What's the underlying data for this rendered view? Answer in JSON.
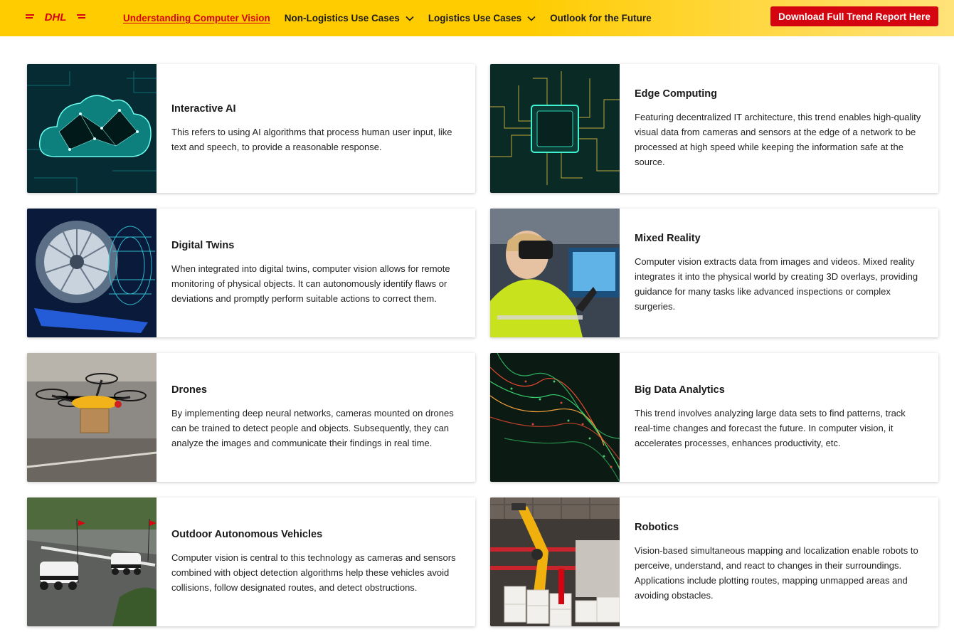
{
  "brand": {
    "logo_text": "DHL",
    "brand_color": "#ffcc00",
    "accent_color": "#d40511"
  },
  "nav": {
    "items": [
      {
        "label": "Understanding Computer Vision",
        "active": true,
        "dropdown": false
      },
      {
        "label": "Non-Logistics Use Cases",
        "active": false,
        "dropdown": true
      },
      {
        "label": "Logistics Use Cases",
        "active": false,
        "dropdown": true
      },
      {
        "label": "Outlook for the Future",
        "active": false,
        "dropdown": false
      }
    ],
    "cta_label": "Download Full Trend Report Here"
  },
  "cards": [
    {
      "title": "Interactive AI",
      "text": "This refers to using AI algorithms that process human user input, like text and speech, to provide a reasonable response.",
      "image": "cloud-network-image"
    },
    {
      "title": "Edge Computing",
      "text": "Featuring decentralized IT architecture, this trend enables high-quality visual data from cameras and sensors at the edge of a network to be processed at high speed while keeping the information safe at the source.",
      "image": "microchip-image"
    },
    {
      "title": "Digital Twins",
      "text": "When integrated into digital twins, computer vision allows for remote monitoring of physical objects. It can autonomously identify flaws or deviations and promptly perform suitable actions to correct them.",
      "image": "jet-engine-image"
    },
    {
      "title": "Mixed Reality",
      "text": "Computer vision extracts data from images and videos. Mixed reality integrates it into the physical world by creating 3D overlays, providing guidance for many tasks like advanced inspections or complex surgeries.",
      "image": "vr-headset-worker-image"
    },
    {
      "title": "Drones",
      "text": "By implementing deep neural networks, cameras mounted on drones can be trained to detect people and objects. Subsequently, they can analyze the images and communicate their findings in real time.",
      "image": "delivery-drone-image"
    },
    {
      "title": "Big Data Analytics",
      "text": "This trend involves analyzing large data sets to find patterns, track real-time changes and forecast the future. In computer vision, it accelerates processes, enhances productivity, etc.",
      "image": "data-waves-image"
    },
    {
      "title": "Outdoor Autonomous Vehicles",
      "text": "Computer vision is central to this technology as cameras and sensors combined with object detection algorithms help these vehicles avoid collisions, follow designated routes, and detect obstructions.",
      "image": "delivery-robots-image"
    },
    {
      "title": "Robotics",
      "text": "Vision-based simultaneous mapping and localization enable robots to perceive, understand, and react to changes in their surroundings. Applications include plotting routes, mapping unmapped areas and avoiding obstacles.",
      "image": "robot-arm-warehouse-image"
    }
  ]
}
